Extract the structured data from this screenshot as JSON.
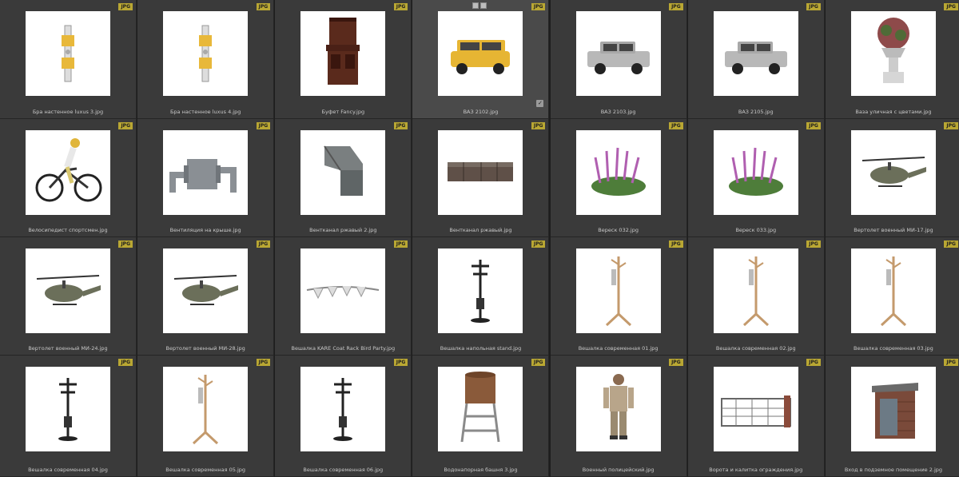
{
  "badge_label": "JPG",
  "items": [
    {
      "caption": "Бра настенное luxus 3.jpg",
      "icon": "wall-lamp"
    },
    {
      "caption": "Бра настенное luxus 4.jpg",
      "icon": "wall-lamp"
    },
    {
      "caption": "Буфет Fancy.jpg",
      "icon": "cabinet"
    },
    {
      "caption": "ВАЗ 2102.jpg",
      "icon": "car-wagon",
      "selected": true
    },
    {
      "caption": "ВАЗ 2103.jpg",
      "icon": "car-sedan"
    },
    {
      "caption": "ВАЗ 2105.jpg",
      "icon": "car-sedan"
    },
    {
      "caption": "Ваза уличная с цветами.jpg",
      "icon": "planter"
    },
    {
      "caption": "Велосипедист спортсмен.jpg",
      "icon": "cyclist"
    },
    {
      "caption": "Вентиляция на крыше.jpg",
      "icon": "ventilation"
    },
    {
      "caption": "Вентканал ржавый 2.jpg",
      "icon": "duct"
    },
    {
      "caption": "Вентканал ржавый.jpg",
      "icon": "duct-long"
    },
    {
      "caption": "Вереск 032.jpg",
      "icon": "heather"
    },
    {
      "caption": "Вереск 033.jpg",
      "icon": "heather"
    },
    {
      "caption": "Вертолет военный МИ-17.jpg",
      "icon": "helicopter"
    },
    {
      "caption": "Вертолет военный МИ-24.jpg",
      "icon": "helicopter"
    },
    {
      "caption": "Вертолет военный МИ-28.jpg",
      "icon": "helicopter"
    },
    {
      "caption": "Вешалка KARE Coat Rack Bird Party.jpg",
      "icon": "wall-rack"
    },
    {
      "caption": "Вешалка напольная stand.jpg",
      "icon": "coat-stand"
    },
    {
      "caption": "Вешалка современная 01.jpg",
      "icon": "coat-stand-wood"
    },
    {
      "caption": "Вешалка современная 02.jpg",
      "icon": "coat-stand-wood"
    },
    {
      "caption": "Вешалка современная 03.jpg",
      "icon": "coat-stand-wood"
    },
    {
      "caption": "Вешалка современная 04.jpg",
      "icon": "coat-stand"
    },
    {
      "caption": "Вешалка современная 05.jpg",
      "icon": "coat-stand-wood"
    },
    {
      "caption": "Вешалка современная 06.jpg",
      "icon": "coat-stand"
    },
    {
      "caption": "Водонапорная башня 3.jpg",
      "icon": "water-tower"
    },
    {
      "caption": "Военный полицейский.jpg",
      "icon": "soldier"
    },
    {
      "caption": "Ворота и калитка ограждения.jpg",
      "icon": "fence"
    },
    {
      "caption": "Вход в подземное помещение 2.jpg",
      "icon": "bunker"
    }
  ]
}
